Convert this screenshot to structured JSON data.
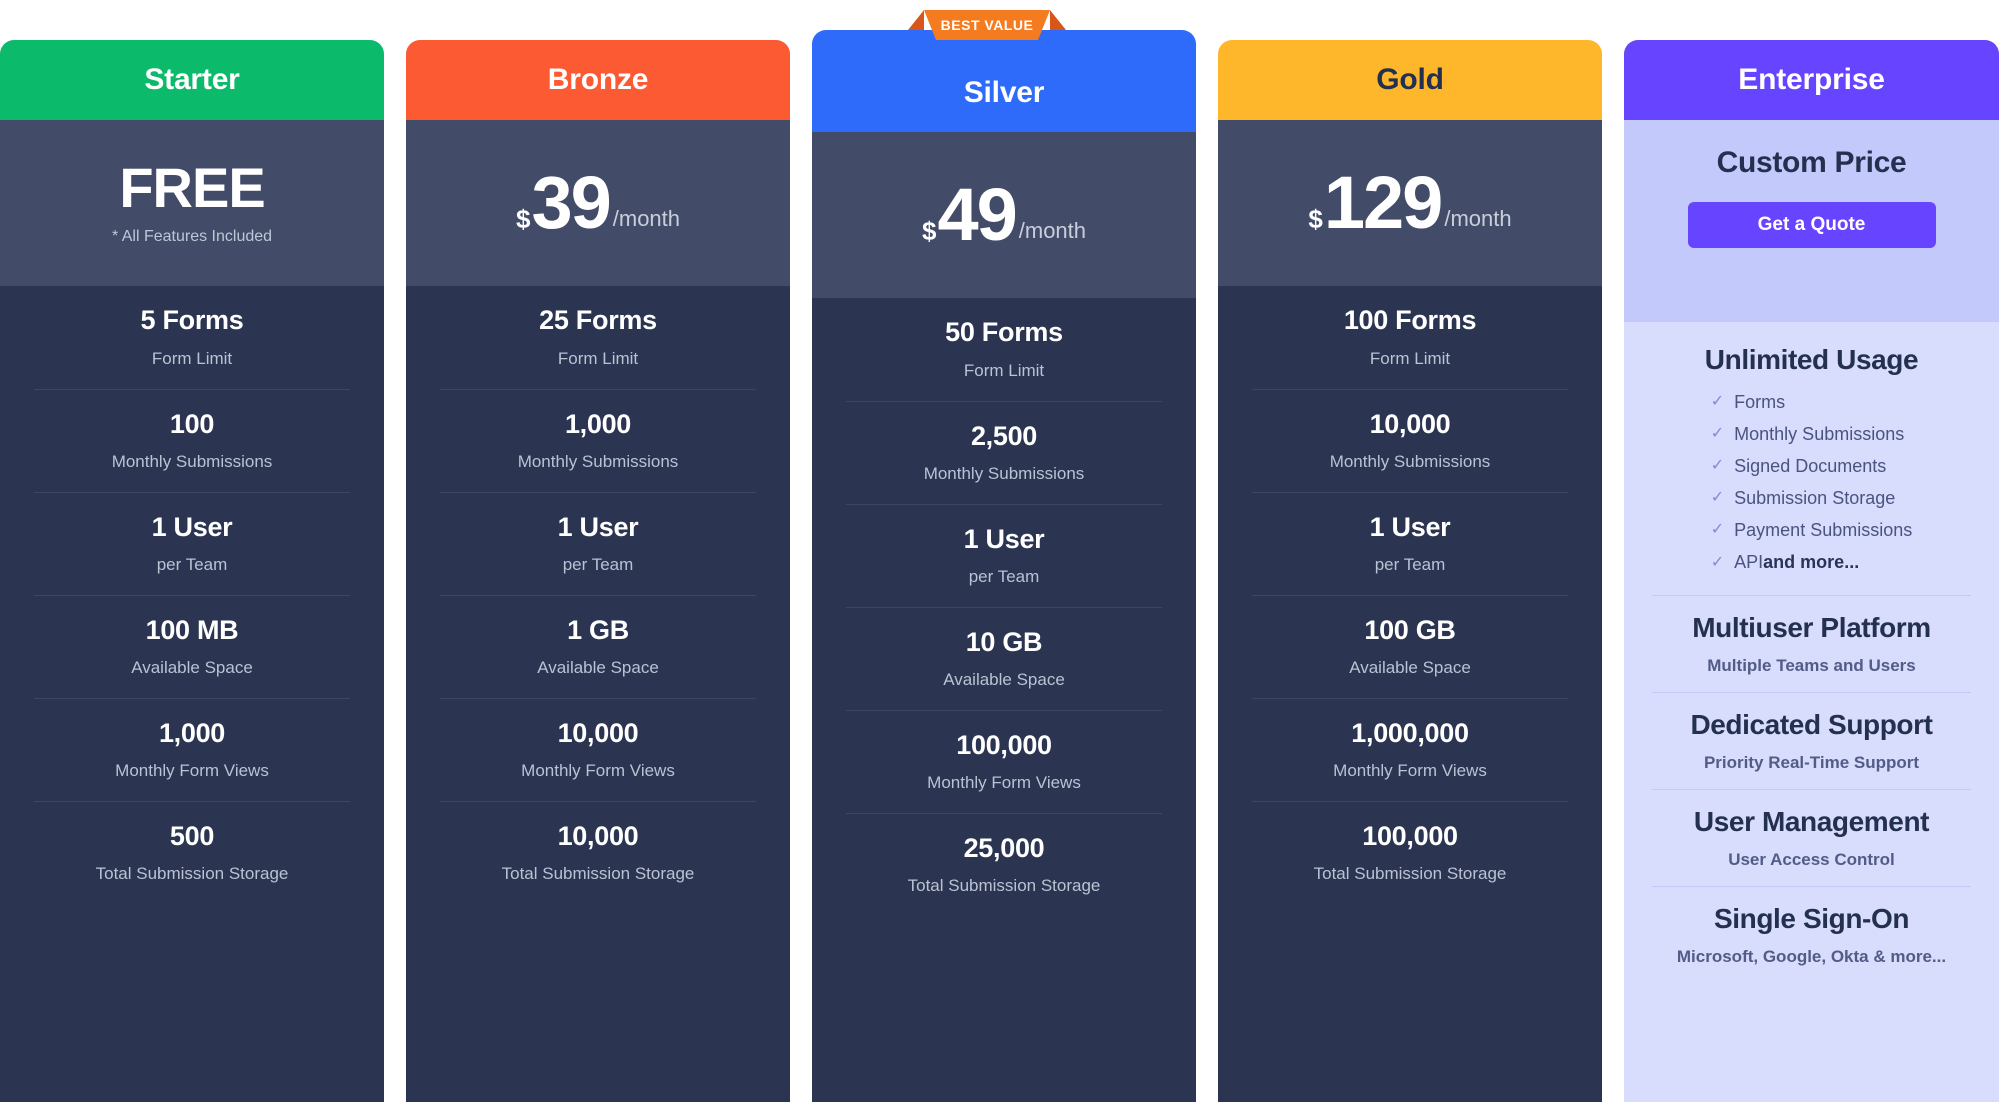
{
  "colors": {
    "page_background": "#ffffff",
    "card_body": "#2B3450",
    "price_block": "#424C68",
    "divider": "#3C4661",
    "starter_accent": "#0CBA6B",
    "bronze_accent": "#FB5A33",
    "silver_accent": "#2F6BFA",
    "gold_accent": "#FEB62B",
    "enterprise_accent": "#6744FF",
    "enterprise_price_bg": "#C4C9FB",
    "enterprise_body_bg": "#D8DCFD",
    "ribbon": "#F57B20",
    "ribbon_fold": "#D9561A",
    "check_icon": "#8E84D8"
  },
  "badge": {
    "label": "BEST VALUE"
  },
  "feature_labels": [
    "Form Limit",
    "Monthly Submissions",
    "per Team",
    "Available Space",
    "Monthly Form Views",
    "Total Submission Storage"
  ],
  "plans": [
    {
      "name": "Starter",
      "header_color": "#0CBA6B",
      "header_text_color": "#ffffff",
      "price_currency": "",
      "price_amount": "FREE",
      "price_period": "",
      "price_note": "* All Features Included",
      "featured": false,
      "features": [
        {
          "value": "5 Forms",
          "label": "Form Limit"
        },
        {
          "value": "100",
          "label": "Monthly Submissions"
        },
        {
          "value": "1 User",
          "label": "per Team"
        },
        {
          "value": "100 MB",
          "label": "Available Space"
        },
        {
          "value": "1,000",
          "label": "Monthly Form Views"
        },
        {
          "value": "500",
          "label": "Total Submission Storage"
        }
      ]
    },
    {
      "name": "Bronze",
      "header_color": "#FB5A33",
      "header_text_color": "#ffffff",
      "price_currency": "$",
      "price_amount": "39",
      "price_period": "/month",
      "price_note": "",
      "featured": false,
      "features": [
        {
          "value": "25 Forms",
          "label": "Form Limit"
        },
        {
          "value": "1,000",
          "label": "Monthly Submissions"
        },
        {
          "value": "1 User",
          "label": "per Team"
        },
        {
          "value": "1 GB",
          "label": "Available Space"
        },
        {
          "value": "10,000",
          "label": "Monthly Form Views"
        },
        {
          "value": "10,000",
          "label": "Total Submission Storage"
        }
      ]
    },
    {
      "name": "Silver",
      "header_color": "#2F6BFA",
      "header_text_color": "#ffffff",
      "price_currency": "$",
      "price_amount": "49",
      "price_period": "/month",
      "price_note": "",
      "featured": true,
      "badge": "BEST VALUE",
      "features": [
        {
          "value": "50 Forms",
          "label": "Form Limit"
        },
        {
          "value": "2,500",
          "label": "Monthly Submissions"
        },
        {
          "value": "1 User",
          "label": "per Team"
        },
        {
          "value": "10 GB",
          "label": "Available Space"
        },
        {
          "value": "100,000",
          "label": "Monthly Form Views"
        },
        {
          "value": "25,000",
          "label": "Total Submission Storage"
        }
      ]
    },
    {
      "name": "Gold",
      "header_color": "#FEB62B",
      "header_text_color": "#24304F",
      "price_currency": "$",
      "price_amount": "129",
      "price_period": "/month",
      "price_note": "",
      "featured": false,
      "features": [
        {
          "value": "100 Forms",
          "label": "Form Limit"
        },
        {
          "value": "10,000",
          "label": "Monthly Submissions"
        },
        {
          "value": "1 User",
          "label": "per Team"
        },
        {
          "value": "100 GB",
          "label": "Available Space"
        },
        {
          "value": "1,000,000",
          "label": "Monthly Form Views"
        },
        {
          "value": "100,000",
          "label": "Total Submission Storage"
        }
      ]
    }
  ],
  "enterprise": {
    "name": "Enterprise",
    "custom_price_title": "Custom Price",
    "quote_button_label": "Get a Quote",
    "sections": [
      {
        "title": "Unlimited Usage",
        "items": [
          {
            "text": "Forms",
            "bold_suffix": ""
          },
          {
            "text": "Monthly Submissions",
            "bold_suffix": ""
          },
          {
            "text": "Signed Documents",
            "bold_suffix": ""
          },
          {
            "text": "Submission Storage",
            "bold_suffix": ""
          },
          {
            "text": "Payment Submissions",
            "bold_suffix": ""
          },
          {
            "text": "API ",
            "bold_suffix": "and more..."
          }
        ]
      },
      {
        "title": "Multiuser Platform",
        "subtitle": "Multiple Teams and Users"
      },
      {
        "title": "Dedicated Support",
        "subtitle": "Priority Real-Time Support"
      },
      {
        "title": "User Management",
        "subtitle": "User Access Control"
      },
      {
        "title": "Single Sign-On",
        "subtitle": "Microsoft, Google, Okta & more..."
      }
    ]
  }
}
